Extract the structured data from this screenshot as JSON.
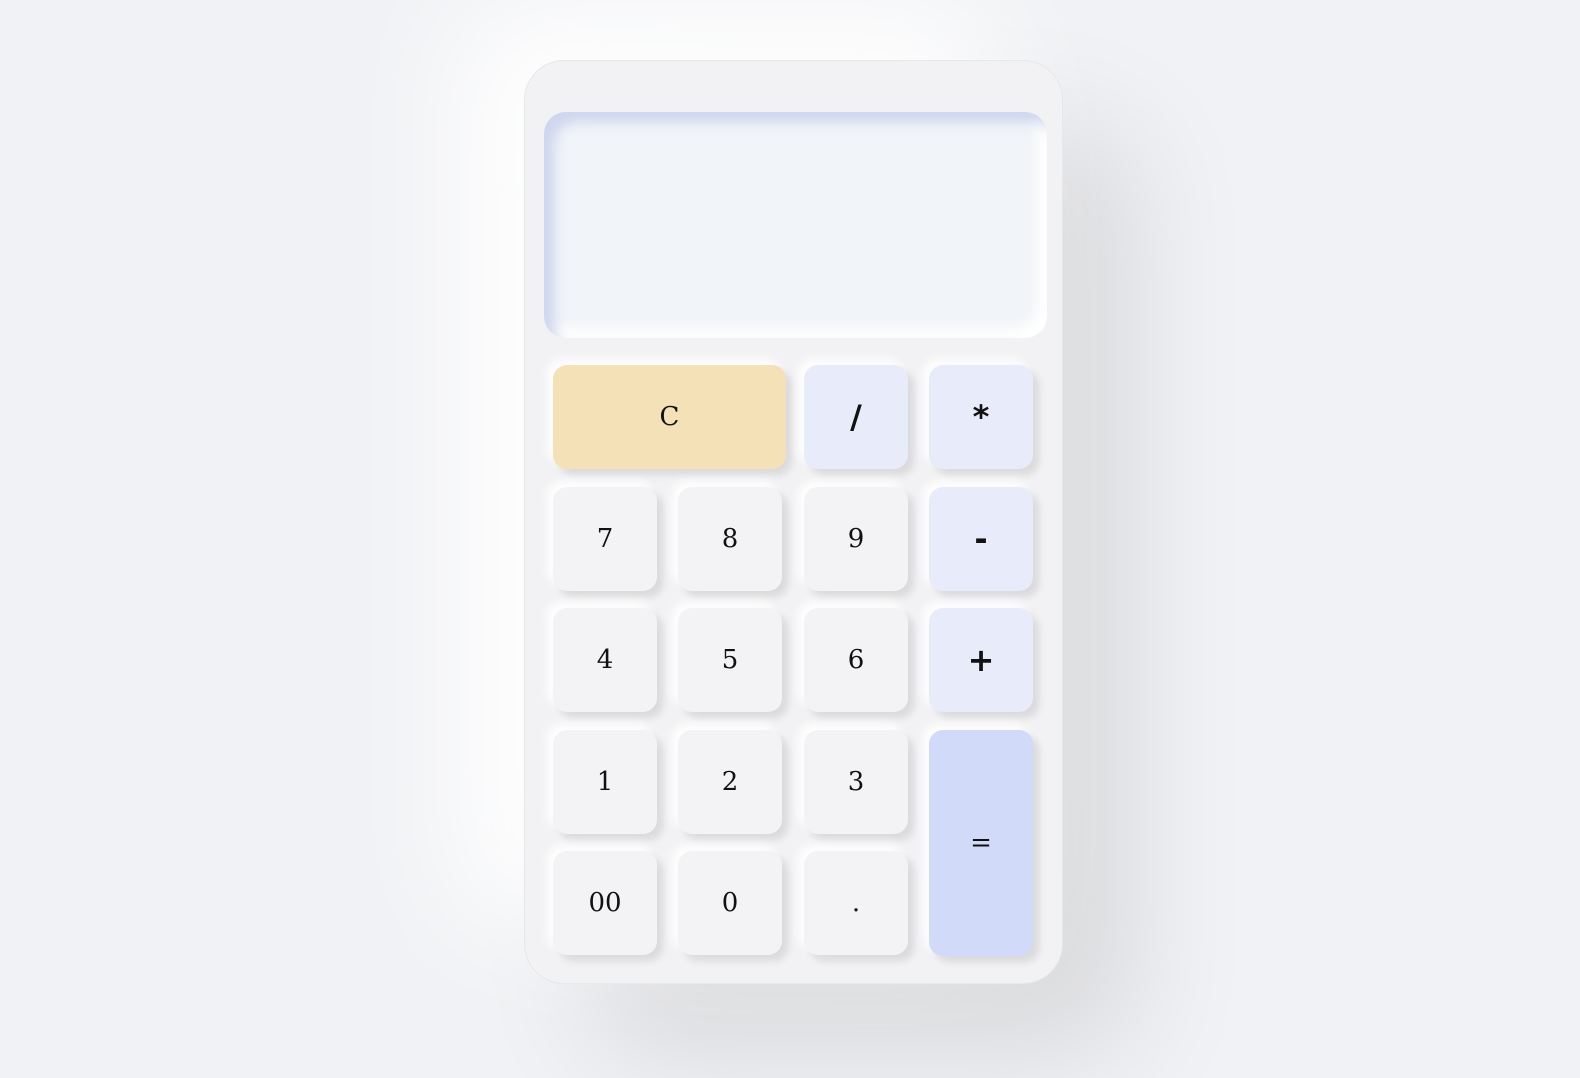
{
  "display": {
    "value": ""
  },
  "keys": {
    "clear": "C",
    "divide": "/",
    "multiply": "*",
    "seven": "7",
    "eight": "8",
    "nine": "9",
    "minus": "-",
    "four": "4",
    "five": "5",
    "six": "6",
    "plus": "+",
    "one": "1",
    "two": "2",
    "three": "3",
    "equals": "=",
    "double_zero": "00",
    "zero": "0",
    "decimal": "."
  },
  "colors": {
    "clear_key": "#f5e1b8",
    "operator_key": "#e7ebfa",
    "equals_key": "#d1daf8",
    "number_key": "#f3f3f5",
    "body": "#f2f2f4"
  }
}
